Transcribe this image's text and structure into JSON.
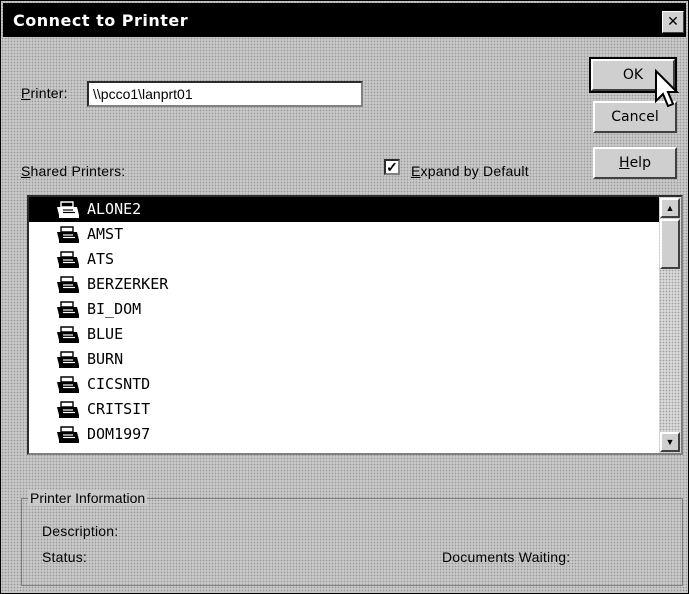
{
  "dialog": {
    "title": "Connect to Printer",
    "close_glyph": "✕"
  },
  "printer_field": {
    "label_key": "P",
    "label_rest": "rinter:",
    "value": "\\\\pcco1\\lanprt01"
  },
  "buttons": {
    "ok": "OK",
    "cancel": "Cancel",
    "help_key": "H",
    "help_rest": "elp"
  },
  "shared_printers": {
    "label_key": "S",
    "label_rest": "hared Printers:",
    "expand_checked": true,
    "expand_key": "E",
    "expand_rest": "xpand by Default",
    "items": [
      {
        "name": "ALONE2",
        "selected": true
      },
      {
        "name": "AMST"
      },
      {
        "name": "ATS"
      },
      {
        "name": "BERZERKER"
      },
      {
        "name": "BI_DOM"
      },
      {
        "name": "BLUE"
      },
      {
        "name": "BURN"
      },
      {
        "name": "CICSNTD"
      },
      {
        "name": "CRITSIT"
      },
      {
        "name": "DOM1997"
      }
    ]
  },
  "printer_info": {
    "legend": "Printer Information",
    "description_label": "Description:",
    "status_label": "Status:",
    "documents_waiting_label": "Documents Waiting:"
  },
  "icons": {
    "printer": "printer-icon",
    "scroll_up": "arrow-up-icon",
    "scroll_down": "arrow-down-icon",
    "cursor": "mouse-pointer-icon"
  }
}
